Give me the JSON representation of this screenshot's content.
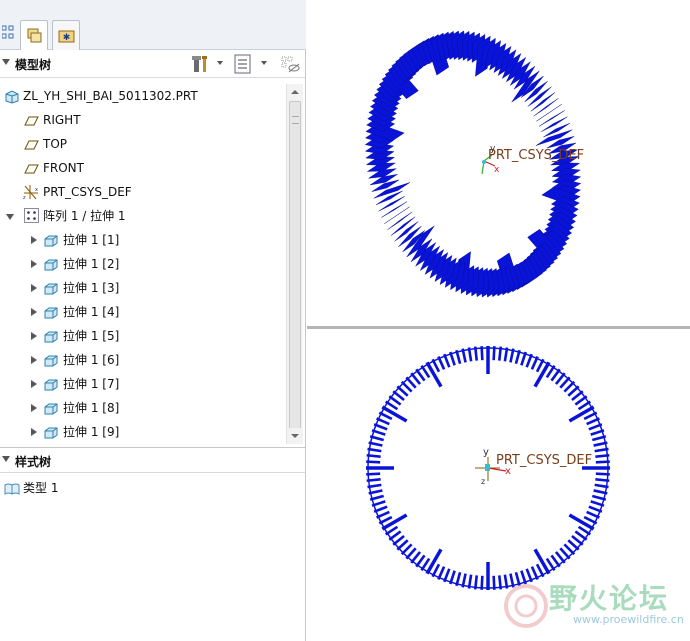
{
  "tabs": [
    {
      "icon": "model-tree-tab-icon",
      "active": true
    },
    {
      "icon": "layer-tab-icon",
      "active": false
    },
    {
      "icon": "favorites-tab-icon",
      "active": false
    }
  ],
  "model_tree": {
    "title": "模型树",
    "root": "ZL_YH_SHI_BAI_5011302.PRT",
    "datums": [
      "RIGHT",
      "TOP",
      "FRONT"
    ],
    "csys": "PRT_CSYS_DEF",
    "pattern": "阵列 1 / 拉伸 1",
    "children": [
      "拉伸 1 [1]",
      "拉伸 1 [2]",
      "拉伸 1 [3]",
      "拉伸 1 [4]",
      "拉伸 1 [5]",
      "拉伸 1 [6]",
      "拉伸 1 [7]",
      "拉伸 1 [8]",
      "拉伸 1 [9]"
    ]
  },
  "style_tree": {
    "title": "样式树",
    "items": [
      "类型 1"
    ]
  },
  "viewport": {
    "csys_label": "PRT_CSYS_DEF",
    "model_color": "#0a14d8",
    "csys_label_color": "#7a3d1a"
  },
  "watermark": {
    "text": "野火论坛",
    "url": "www.proewildfire.cn"
  }
}
